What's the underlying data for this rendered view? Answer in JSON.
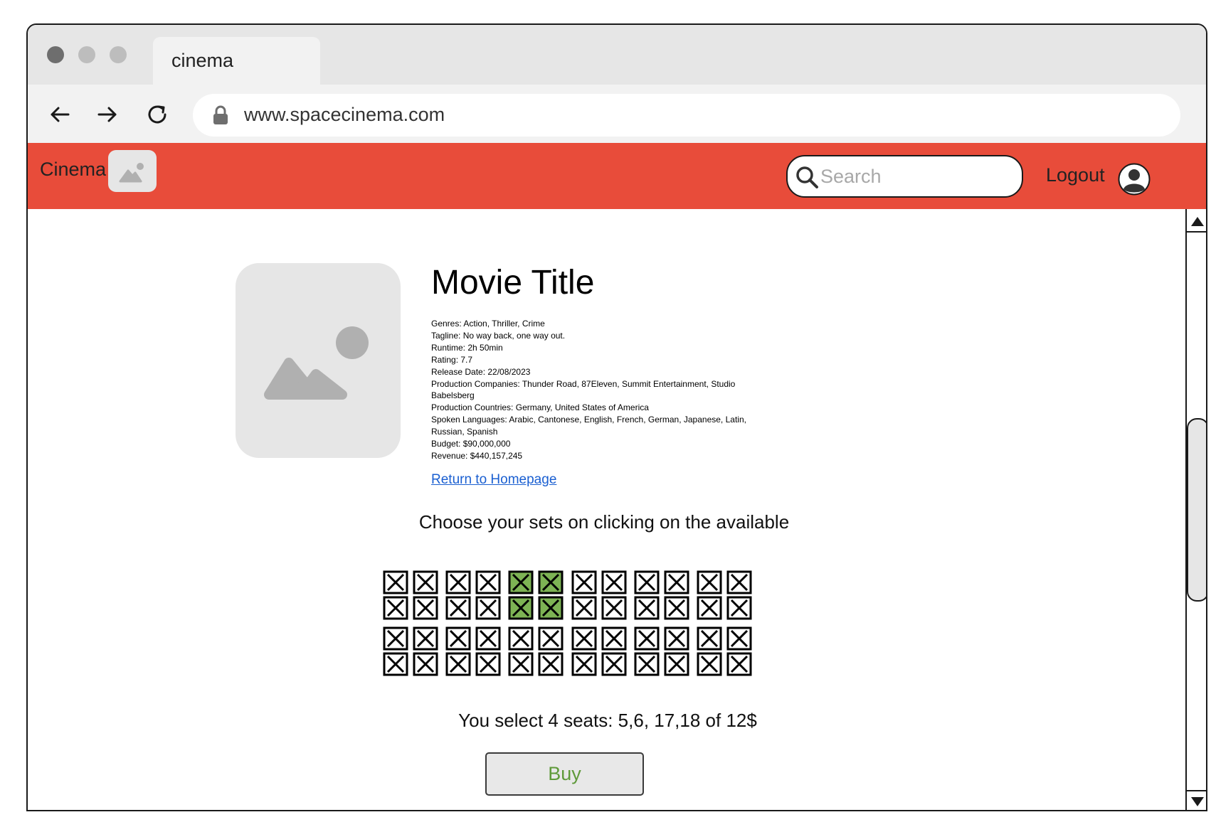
{
  "browser": {
    "tab_title": "cinema",
    "url": "www.spacecinema.com"
  },
  "header": {
    "brand": "Cinema",
    "search_placeholder": "Search",
    "logout_label": "Logout",
    "accent_color": "#e84c3a"
  },
  "movie": {
    "title": "Movie Title",
    "details": [
      "Genres: Action, Thriller, Crime",
      "Tagline: No way back, one way out.",
      "Runtime: 2h 50min",
      "Rating: 7.7",
      "Release Date: 22/08/2023",
      "Production Companies: Thunder Road, 87Eleven, Summit Entertainment, Studio Babelsberg",
      "Production Countries: Germany, United States of America",
      "Spoken Languages: Arabic, Cantonese, English, French, German, Japanese, Latin, Russian, Spanish",
      "Budget: $90,000,000",
      "Revenue: $440,157,245"
    ],
    "return_link": "Return to Homepage"
  },
  "seating": {
    "instructions": "Choose your sets on clicking on the available",
    "rows": 4,
    "cols": 12,
    "selected_seats": [
      5,
      6,
      17,
      18
    ],
    "selected_color": "#7db354",
    "summary": "You select 4 seats: 5,6, 17,18 of 12$",
    "buy_label": "Buy"
  }
}
